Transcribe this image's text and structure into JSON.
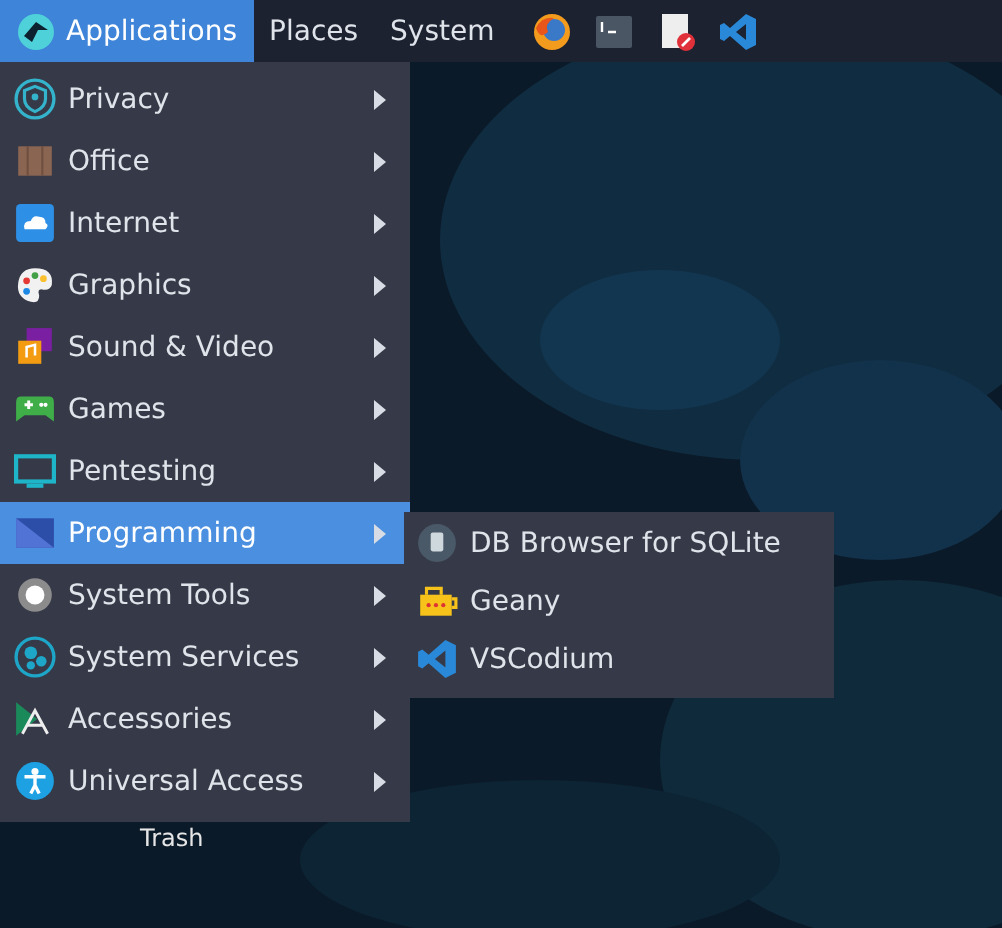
{
  "panel": {
    "menus": [
      {
        "label": "Applications",
        "selected": true
      },
      {
        "label": "Places",
        "selected": false
      },
      {
        "label": "System",
        "selected": false
      }
    ],
    "launchers": [
      {
        "kind": "browser"
      },
      {
        "kind": "terminal"
      },
      {
        "kind": "notes"
      },
      {
        "kind": "code"
      }
    ]
  },
  "desktop": {
    "icons": [
      {
        "label": "Trash"
      }
    ]
  },
  "menu": {
    "items": [
      {
        "label": "Privacy",
        "selected": false
      },
      {
        "label": "Office",
        "selected": false
      },
      {
        "label": "Internet",
        "selected": false
      },
      {
        "label": "Graphics",
        "selected": false
      },
      {
        "label": "Sound & Video",
        "selected": false
      },
      {
        "label": "Games",
        "selected": false
      },
      {
        "label": "Pentesting",
        "selected": false
      },
      {
        "label": "Programming",
        "selected": true
      },
      {
        "label": "System Tools",
        "selected": false
      },
      {
        "label": "System Services",
        "selected": false
      },
      {
        "label": "Accessories",
        "selected": false
      },
      {
        "label": "Universal Access",
        "selected": false
      }
    ]
  },
  "submenu": {
    "items": [
      {
        "label": "DB Browser for SQLite"
      },
      {
        "label": "Geany"
      },
      {
        "label": "VSCodium"
      }
    ]
  }
}
